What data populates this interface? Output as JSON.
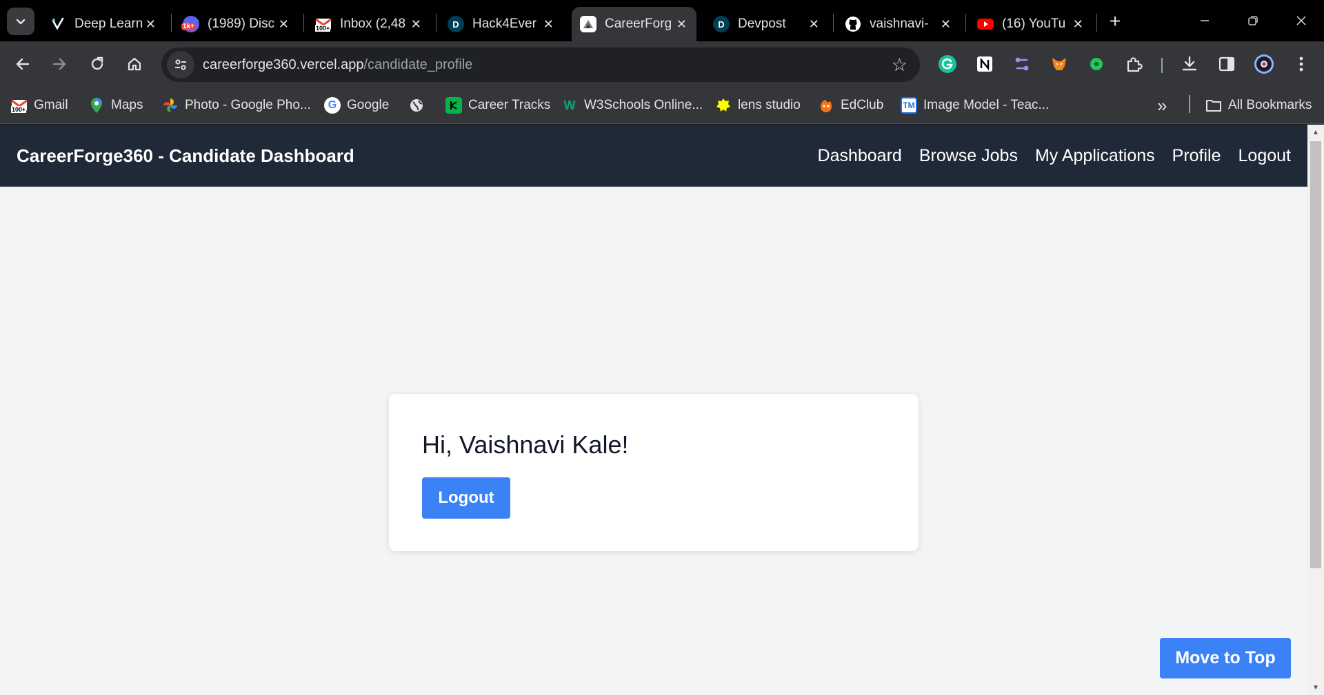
{
  "browser": {
    "tabs": [
      {
        "title": "Deep Learn",
        "icon": "v-logo-icon",
        "color": "#ffffff"
      },
      {
        "title": "(1989) Disc",
        "icon": "discord-icon",
        "color": "#5865f2",
        "badge": "1k+"
      },
      {
        "title": "Inbox (2,48",
        "icon": "gmail-icon",
        "color": "#ea4335",
        "badge": "100+"
      },
      {
        "title": "Hack4Ever",
        "icon": "devpost-icon",
        "color": "#003e54",
        "letter": "D"
      },
      {
        "title": "CareerForg",
        "icon": "careerforge-icon",
        "color": "#ffffff",
        "active": true
      },
      {
        "title": "Devpost",
        "icon": "devpost-icon",
        "color": "#003e54",
        "letter": "D"
      },
      {
        "title": "vaishnavi-",
        "icon": "github-icon",
        "color": "#ffffff"
      },
      {
        "title": "(16) YouTu",
        "icon": "youtube-icon",
        "color": "#ff0000"
      }
    ],
    "close_glyph": "✕",
    "new_tab_glyph": "+",
    "address": {
      "host": "careerforge360.vercel.app",
      "path": "/candidate_profile"
    },
    "bookmarks": [
      {
        "label": "Gmail",
        "icon": "gmail-icon",
        "badge": "100+"
      },
      {
        "label": "Maps",
        "icon": "maps-pin-icon"
      },
      {
        "label": "Photo - Google Pho...",
        "icon": "google-photos-icon"
      },
      {
        "label": "Google",
        "icon": "google-icon",
        "letter": "G"
      },
      {
        "label": "",
        "icon": "globe-icon"
      },
      {
        "label": "Career Tracks",
        "icon": "career-tracks-icon"
      },
      {
        "label": "W3Schools Online...",
        "icon": "w3schools-icon",
        "letter": "W"
      },
      {
        "label": "lens studio",
        "icon": "lens-studio-icon"
      },
      {
        "label": "EdClub",
        "icon": "edclub-icon"
      },
      {
        "label": "Image Model - Teac...",
        "icon": "teachable-machine-icon",
        "letter": "TM"
      }
    ],
    "more_bookmarks_glyph": "»",
    "all_bookmarks": "All Bookmarks"
  },
  "app": {
    "brand": "CareerForge360 - Candidate Dashboard",
    "nav": [
      "Dashboard",
      "Browse Jobs",
      "My Applications",
      "Profile",
      "Logout"
    ],
    "greeting": "Hi, Vaishnavi Kale!",
    "logout_label": "Logout",
    "move_top_label": "Move to Top",
    "accent": "#3b82f6",
    "nav_bg": "#1f2937",
    "page_bg": "#f3f4f6"
  }
}
